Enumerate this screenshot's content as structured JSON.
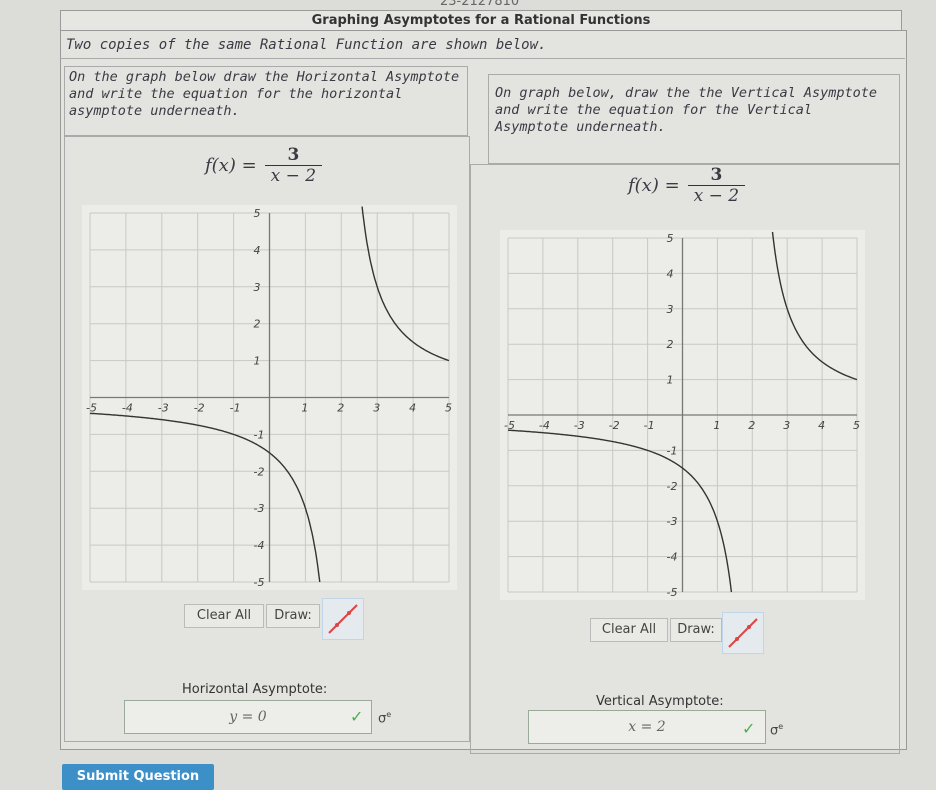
{
  "header": {
    "id_fragment": "23-2127810",
    "title": "Graphing Asymptotes for a Rational Functions"
  },
  "intro": "Two copies of the same Rational Function are shown below.",
  "left": {
    "instruction": "On the graph below draw the Horizontal Asymptote and write the equation for the horizontal asymptote underneath.",
    "function_lhs": "f(x) =",
    "numerator": "3",
    "denominator": "x − 2",
    "clear_label": "Clear All",
    "draw_label": "Draw:",
    "answer_label": "Horizontal Asymptote:",
    "answer_value": "y = 0"
  },
  "right": {
    "instruction": "On graph below, draw the the Vertical Asymptote and write the equation for the Vertical Asymptote underneath.",
    "function_lhs": "f(x) =",
    "numerator": "3",
    "denominator": "x − 2",
    "clear_label": "Clear All",
    "draw_label": "Draw:",
    "answer_label": "Vertical Asymptote:",
    "answer_value": "x = 2"
  },
  "axis": {
    "x_ticks": [
      "-5",
      "-4",
      "-3",
      "-2",
      "-1",
      "1",
      "2",
      "3",
      "4",
      "5"
    ],
    "y_ticks_pos": [
      "5",
      "4",
      "3",
      "2",
      "1"
    ],
    "y_ticks_neg": [
      "-1",
      "-2",
      "-3",
      "-4",
      "-5"
    ]
  },
  "icons": {
    "check": "checkmark-icon",
    "sigma": "sigma-icon",
    "draw": "line-tool-icon"
  },
  "colors": {
    "submit": "#3d8fc8",
    "check": "#4caf50",
    "curve": "#333333"
  },
  "submit_label": "Submit Question"
}
